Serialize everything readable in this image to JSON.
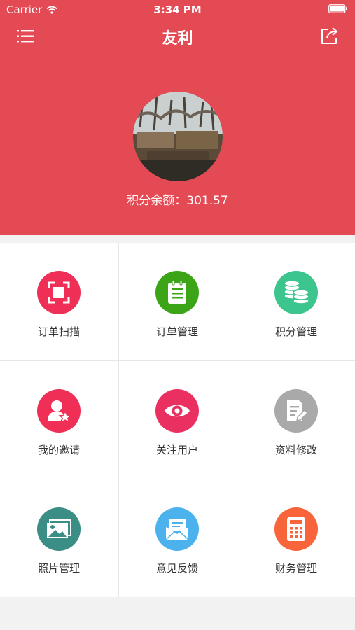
{
  "status_bar": {
    "carrier": "Carrier",
    "time": "3:34 PM"
  },
  "nav": {
    "title": "友利"
  },
  "profile": {
    "points_label": "积分余额：301.57"
  },
  "menu": [
    {
      "label": "订单扫描",
      "icon": "scan-icon",
      "color": "#ef2f55"
    },
    {
      "label": "订单管理",
      "icon": "clipboard-icon",
      "color": "#3ba517"
    },
    {
      "label": "积分管理",
      "icon": "coins-icon",
      "color": "#3cc58d"
    },
    {
      "label": "我的邀请",
      "icon": "user-star-icon",
      "color": "#ef2f55"
    },
    {
      "label": "关注用户",
      "icon": "eye-icon",
      "color": "#ea2f61"
    },
    {
      "label": "资料修改",
      "icon": "edit-document-icon",
      "color": "#a9a9a9"
    },
    {
      "label": "照片管理",
      "icon": "photo-icon",
      "color": "#3a8e86"
    },
    {
      "label": "意见反馈",
      "icon": "mail-icon",
      "color": "#4cb2ee"
    },
    {
      "label": "财务管理",
      "icon": "calculator-icon",
      "color": "#f8653b"
    }
  ]
}
